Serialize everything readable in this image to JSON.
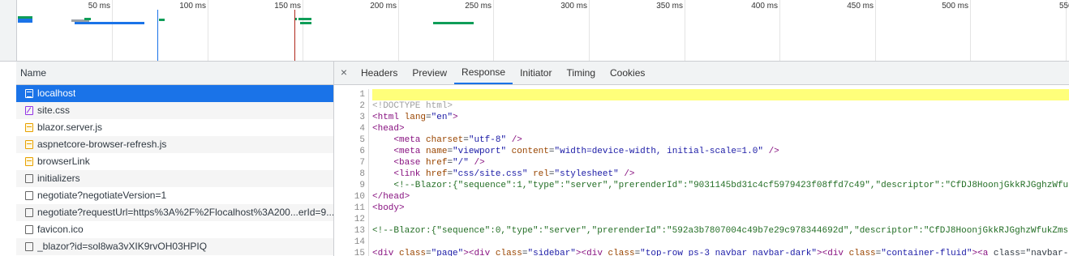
{
  "overview": {
    "ticks": [
      "50 ms",
      "100 ms",
      "150 ms",
      "200 ms",
      "250 ms",
      "300 ms",
      "350 ms",
      "400 ms",
      "450 ms",
      "500 ms",
      "550"
    ],
    "marker_colors": {
      "dom_content_loaded": "#1a73e8",
      "load": "#b0271b"
    }
  },
  "name_column": {
    "header": "Name",
    "requests": [
      {
        "name": "localhost",
        "icon": "document-icon"
      },
      {
        "name": "site.css",
        "icon": "stylesheet-icon"
      },
      {
        "name": "blazor.server.js",
        "icon": "script-icon"
      },
      {
        "name": "aspnetcore-browser-refresh.js",
        "icon": "script-icon"
      },
      {
        "name": "browserLink",
        "icon": "script-icon"
      },
      {
        "name": "initializers",
        "icon": "file-icon"
      },
      {
        "name": "negotiate?negotiateVersion=1",
        "icon": "file-icon"
      },
      {
        "name": "negotiate?requestUrl=https%3A%2F%2Flocalhost%3A200...erId=9...",
        "icon": "file-icon"
      },
      {
        "name": "favicon.ico",
        "icon": "file-icon"
      },
      {
        "name": "_blazor?id=sol8wa3vXIK9rvOH03HPIQ",
        "icon": "file-icon"
      }
    ]
  },
  "detail_tabs": {
    "close": "×",
    "tabs": [
      "Headers",
      "Preview",
      "Response",
      "Initiator",
      "Timing",
      "Cookies"
    ],
    "active": "Response"
  },
  "response_lines": [
    {
      "n": "1",
      "text": ""
    },
    {
      "n": "2",
      "text": "<!DOCTYPE html>"
    },
    {
      "n": "3",
      "text": "<html lang=\"en\">"
    },
    {
      "n": "4",
      "text": "<head>"
    },
    {
      "n": "5",
      "text": "    <meta charset=\"utf-8\" />"
    },
    {
      "n": "6",
      "text": "    <meta name=\"viewport\" content=\"width=device-width, initial-scale=1.0\" />"
    },
    {
      "n": "7",
      "text": "    <base href=\"/\" />"
    },
    {
      "n": "8",
      "text": "    <link href=\"css/site.css\" rel=\"stylesheet\" />"
    },
    {
      "n": "9",
      "text": "    <!--Blazor:{\"sequence\":1,\"type\":\"server\",\"prerenderId\":\"9031145bd31c4cf5979423f08ffd7c49\",\"descriptor\":\"CfDJ8HoonjGkkRJGghzWfuk"
    },
    {
      "n": "10",
      "text": "</head>"
    },
    {
      "n": "11",
      "text": "<body>"
    },
    {
      "n": "12",
      "text": ""
    },
    {
      "n": "13",
      "text": "<!--Blazor:{\"sequence\":0,\"type\":\"server\",\"prerenderId\":\"592a3b7807004c49b7e29c978344692d\",\"descriptor\":\"CfDJ8HoonjGkkRJGghzWfukZmsh"
    },
    {
      "n": "14",
      "text": ""
    },
    {
      "n": "15",
      "text": "<div class=\"page\"><div class=\"sidebar\"><div class=\"top-row ps-3 navbar navbar-dark\"><div class=\"container-fluid\"><a class=\"navbar-b"
    }
  ]
}
